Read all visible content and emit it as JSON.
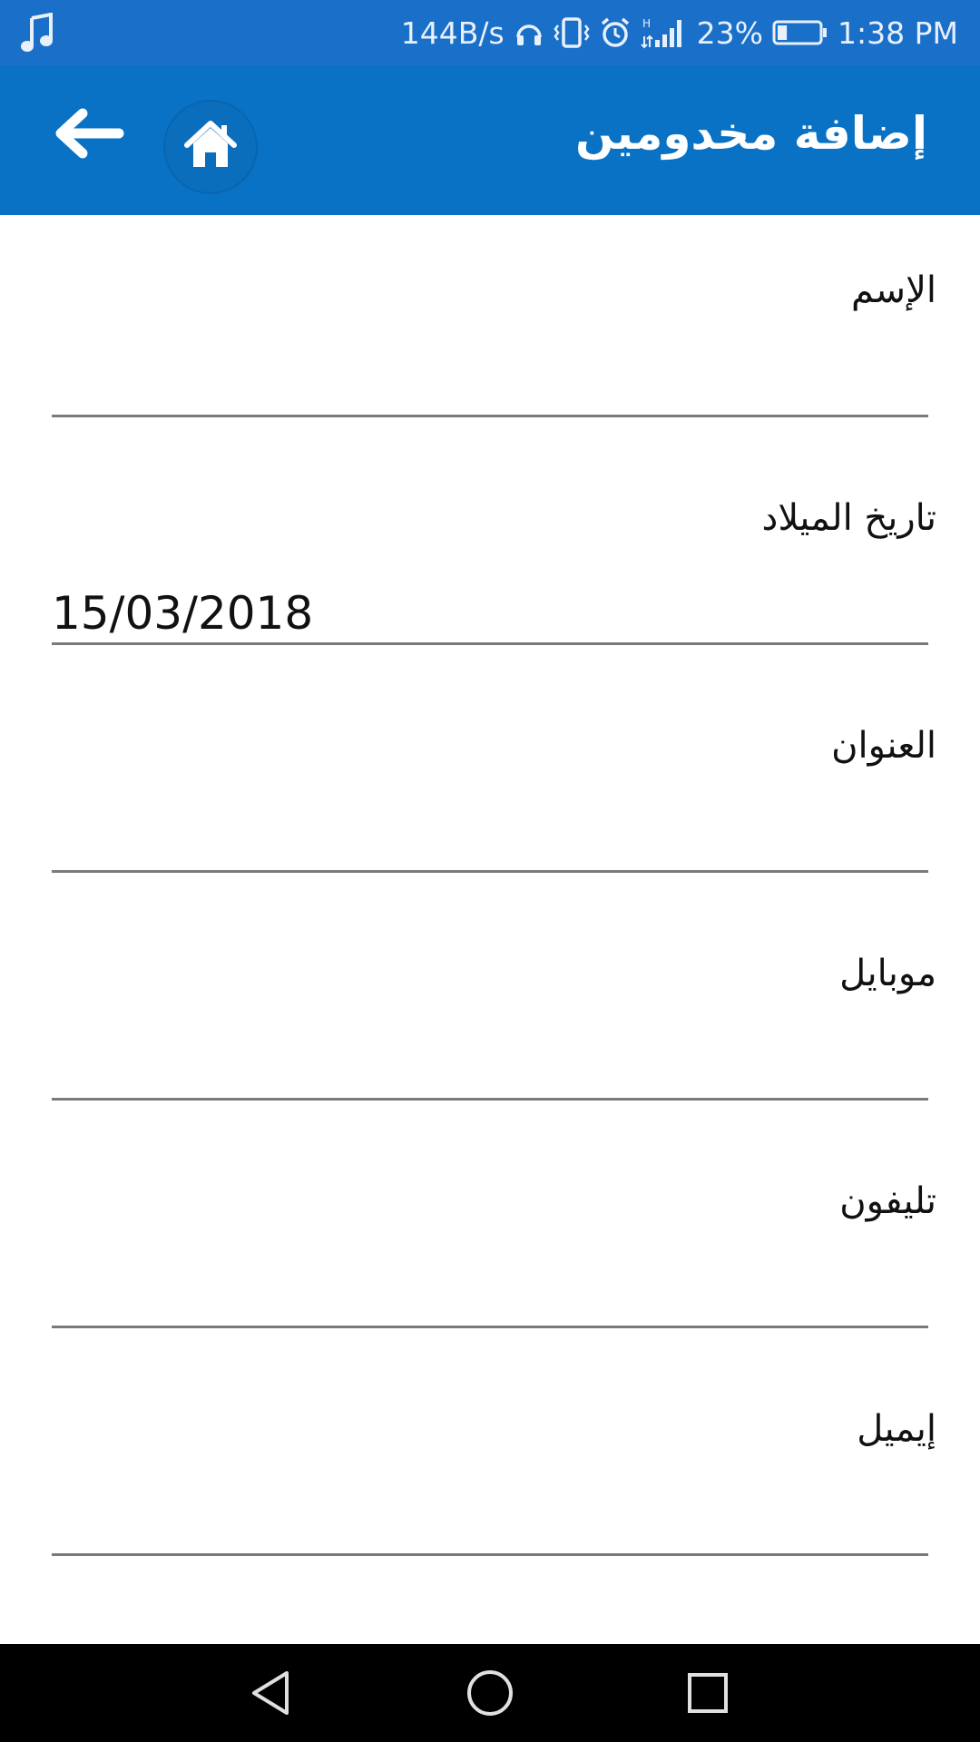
{
  "status_bar": {
    "network_speed": "144B/s",
    "battery_percent": "23%",
    "time": "1:38 PM",
    "battery_level": 0.23,
    "icons": [
      "music-note-icon",
      "headphones-icon",
      "vibrate-icon",
      "alarm-icon",
      "signal-icon",
      "battery-icon"
    ]
  },
  "app_bar": {
    "title": "إضافة مخدومين",
    "back_icon": "arrow-left-icon",
    "home_icon": "home-icon",
    "color": "#0a72c4"
  },
  "form": {
    "fields": [
      {
        "label": "الإسم",
        "value": ""
      },
      {
        "label": "تاريخ الميلاد",
        "value": "15/03/2018"
      },
      {
        "label": "العنوان",
        "value": ""
      },
      {
        "label": "موبايل",
        "value": ""
      },
      {
        "label": "تليفون",
        "value": ""
      },
      {
        "label": "إيميل",
        "value": ""
      }
    ]
  },
  "nav_bar": {
    "icons": [
      "nav-back-icon",
      "nav-home-icon",
      "nav-recents-icon"
    ]
  }
}
